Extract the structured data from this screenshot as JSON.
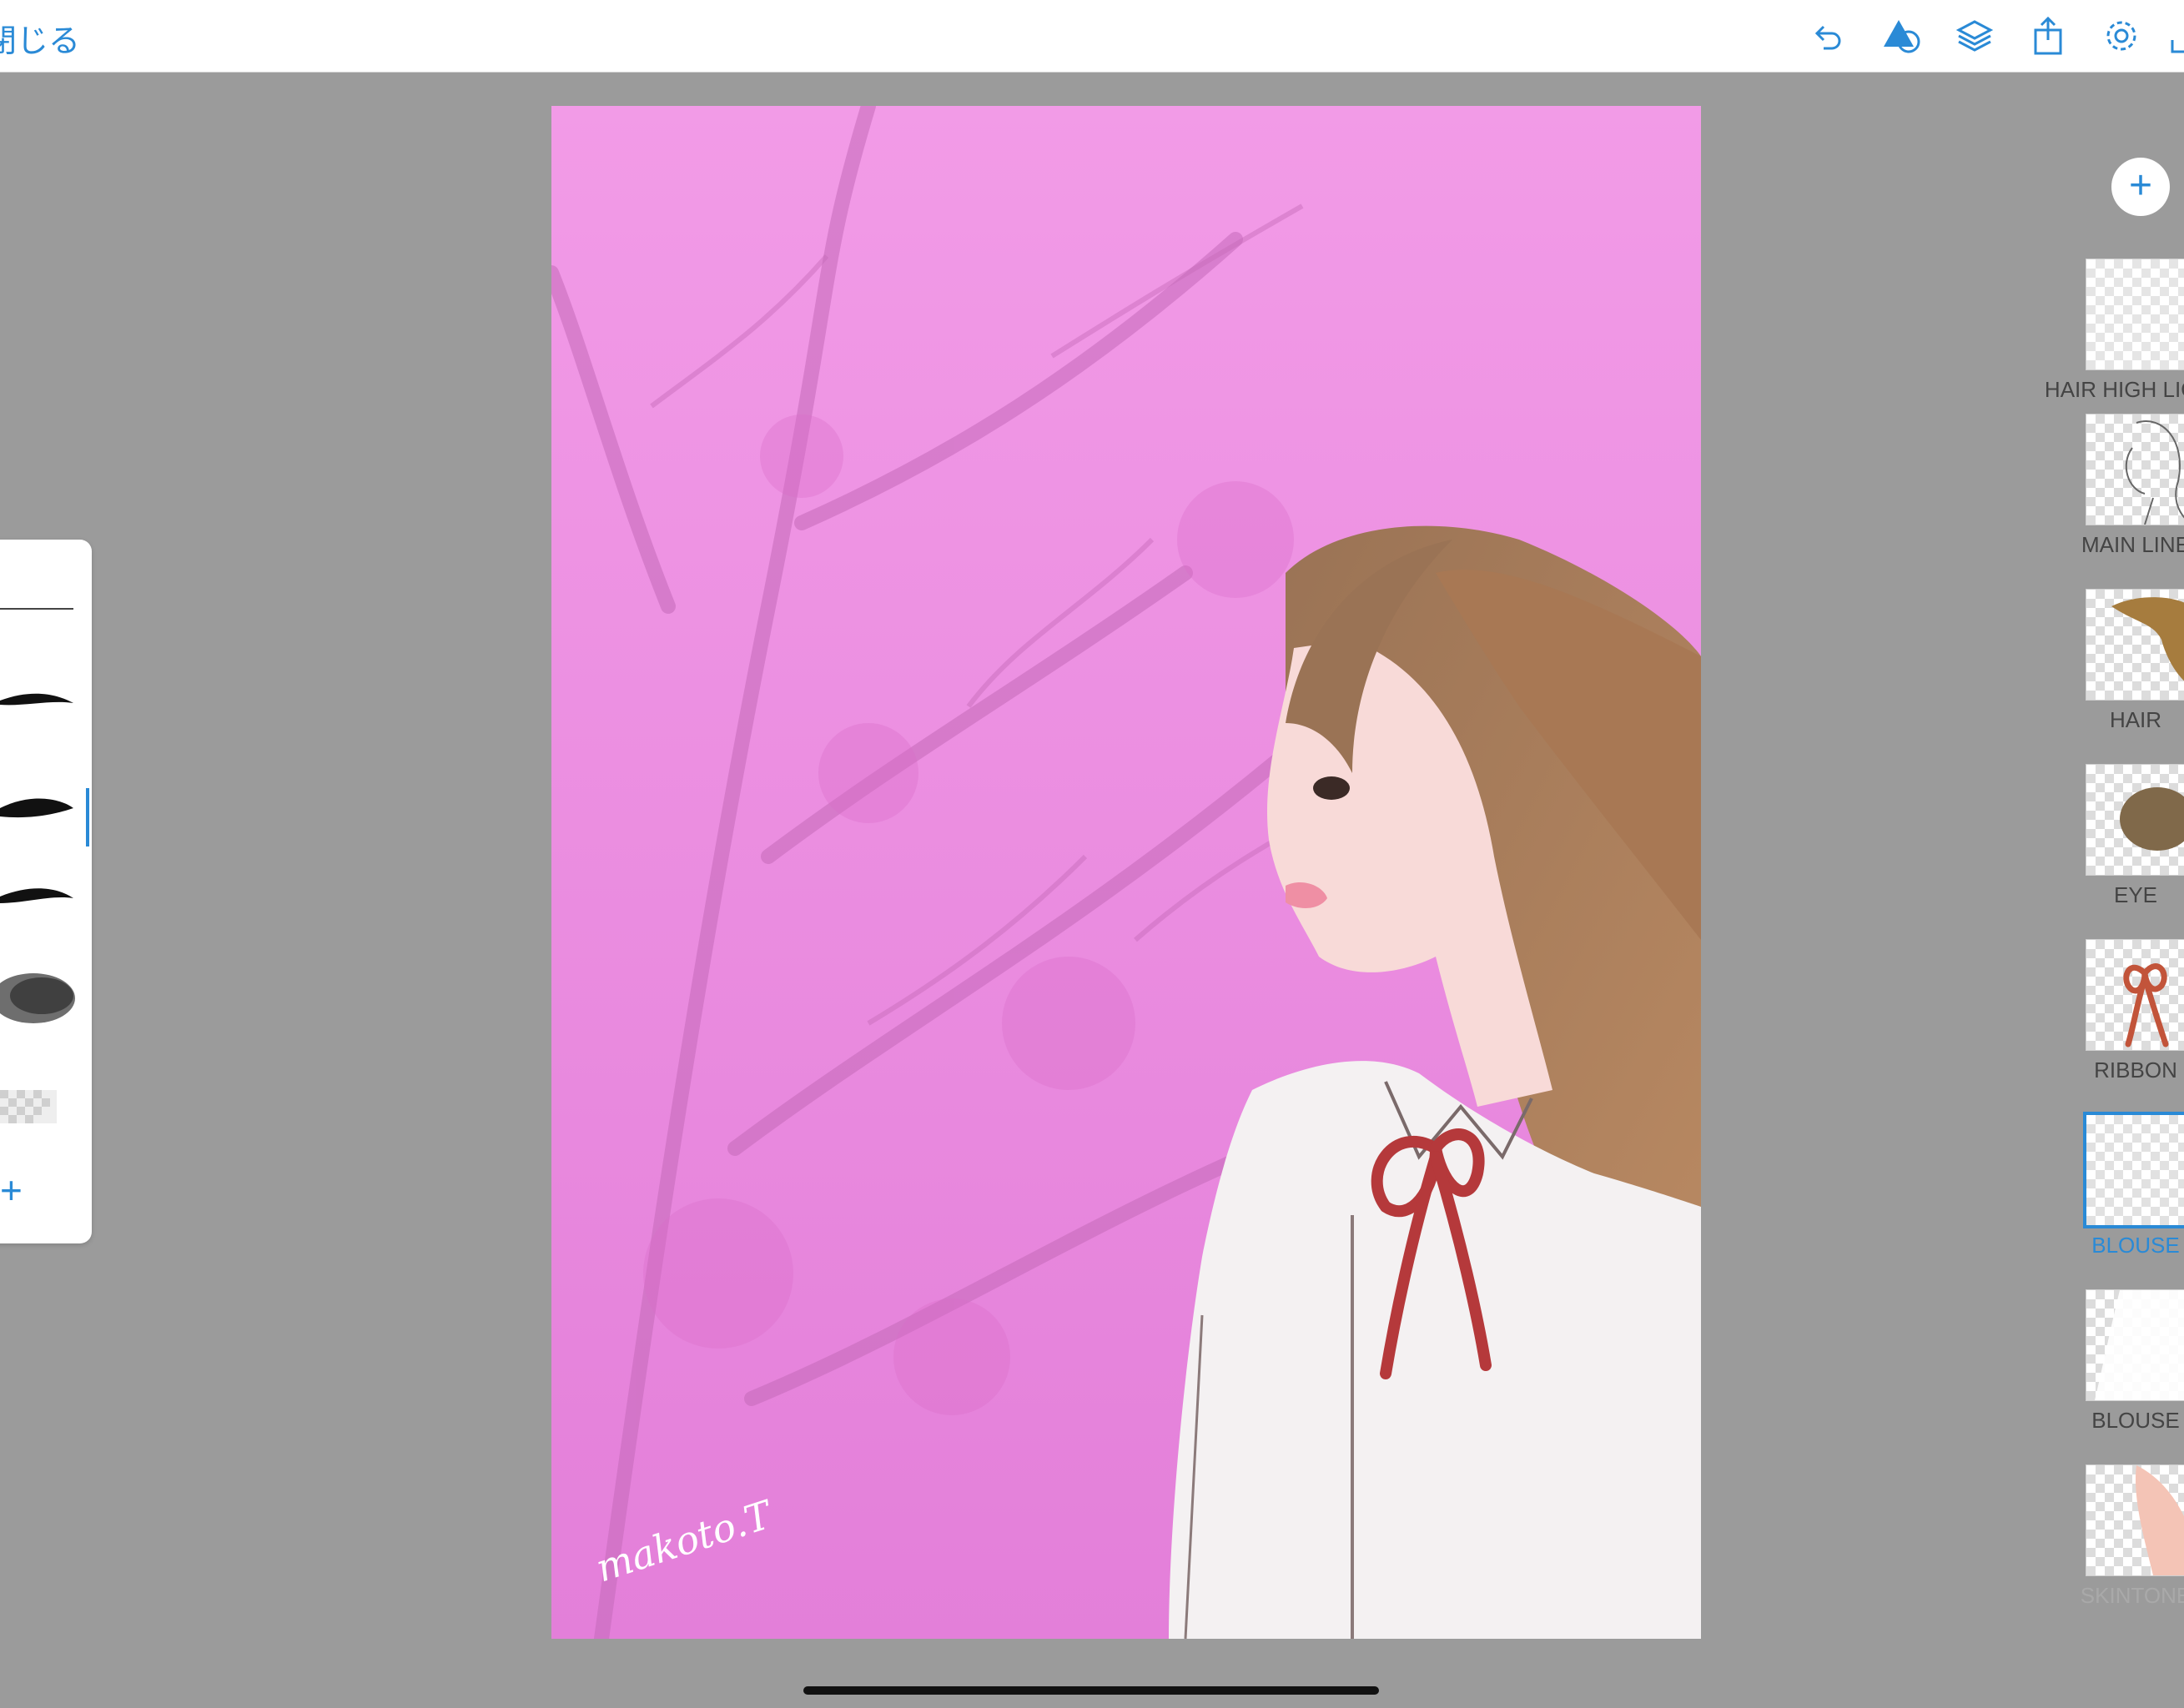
{
  "toolbar": {
    "close_label": "閉じる",
    "icons": [
      "undo-icon",
      "shapes-icon",
      "layers-icon",
      "share-icon",
      "settings-icon",
      "fullscreen-icon"
    ]
  },
  "colors": {
    "accent": "#2a8ad6",
    "workspace": "#9b9b9b",
    "canvas_pink": "#ec8fe0",
    "hair": "#a87854",
    "ribbon": "#b5393b"
  },
  "canvas": {
    "signature": "makoto.T"
  },
  "brushes": [
    "fine-pen",
    "tapered-brush-1",
    "tapered-brush-2",
    "tapered-brush-3",
    "watercolor-brush",
    "eraser-brush"
  ],
  "layers": [
    {
      "label": "HAIR HIGH LIGHT"
    },
    {
      "label": "MAIN LINE"
    },
    {
      "label": "HAIR"
    },
    {
      "label": "EYE"
    },
    {
      "label": "RIBBON"
    },
    {
      "label": "BLOUSE"
    },
    {
      "label": "BLOUSE"
    },
    {
      "label": "SKINTONE"
    }
  ]
}
